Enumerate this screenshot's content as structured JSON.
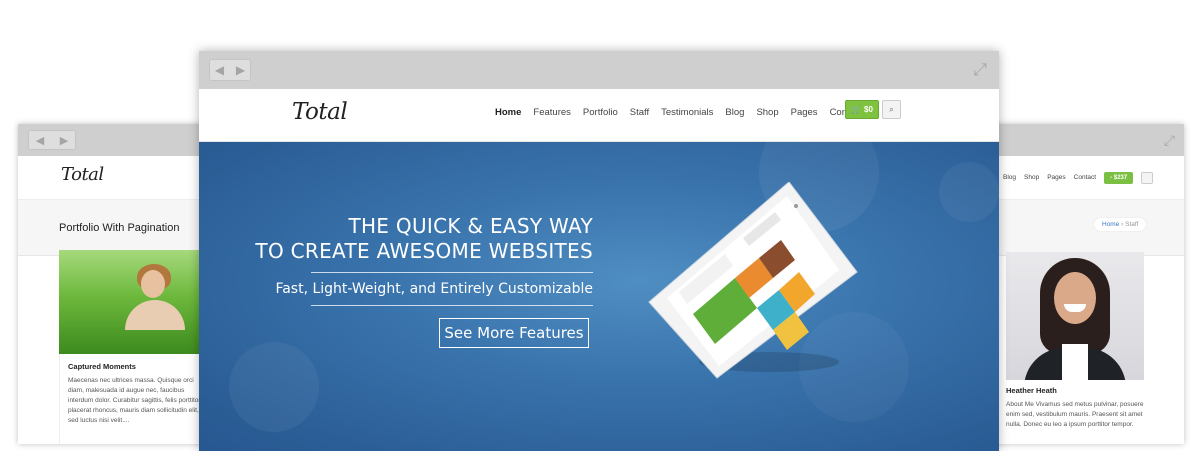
{
  "left_window": {
    "logo": "Total",
    "page_title": "Portfolio With Pagination",
    "card_title": "Captured Moments",
    "card_text": "Maecenas nec ultrices massa. Quisque orci diam, malesuada id augue nec, faucibus interdum dolor. Curabitur sagittis, felis porttitor placerat rhoncus, mauris diam sollicitudin elit, sed luctus nisi velit...."
  },
  "right_window": {
    "nav": [
      "Blog",
      "Shop",
      "Pages",
      "Contact"
    ],
    "cart_label": "$237",
    "breadcrumb_home": "Home",
    "breadcrumb_current": "Staff",
    "card_title": "Heather Heath",
    "card_text": "About Me Vivamus sed metus pulvinar, posuere enim sed, vestibulum mauris. Praesent sit amet nulla. Donec eu leo a ipsum porttitor tempor."
  },
  "front_window": {
    "logo": "Total",
    "nav": [
      "Home",
      "Features",
      "Portfolio",
      "Staff",
      "Testimonials",
      "Blog",
      "Shop",
      "Pages",
      "Contact"
    ],
    "active_nav": "Home",
    "cart_label": "$0",
    "headline_line1": "THE QUICK & EASY WAY",
    "headline_line2": "TO CREATE AWESOME WEBSITES",
    "subheadline": "Fast, Light-Weight, and Entirely Customizable",
    "cta_label": "See More Features"
  },
  "icons": [
    "back-arrow-icon",
    "forward-arrow-icon",
    "expand-icon",
    "cart-icon",
    "search-icon"
  ],
  "colors": {
    "chrome": "#cfcfcf",
    "hero_blue": "#3a74ad",
    "cart_green": "#7ec23f",
    "link_blue": "#3a7bc2"
  }
}
